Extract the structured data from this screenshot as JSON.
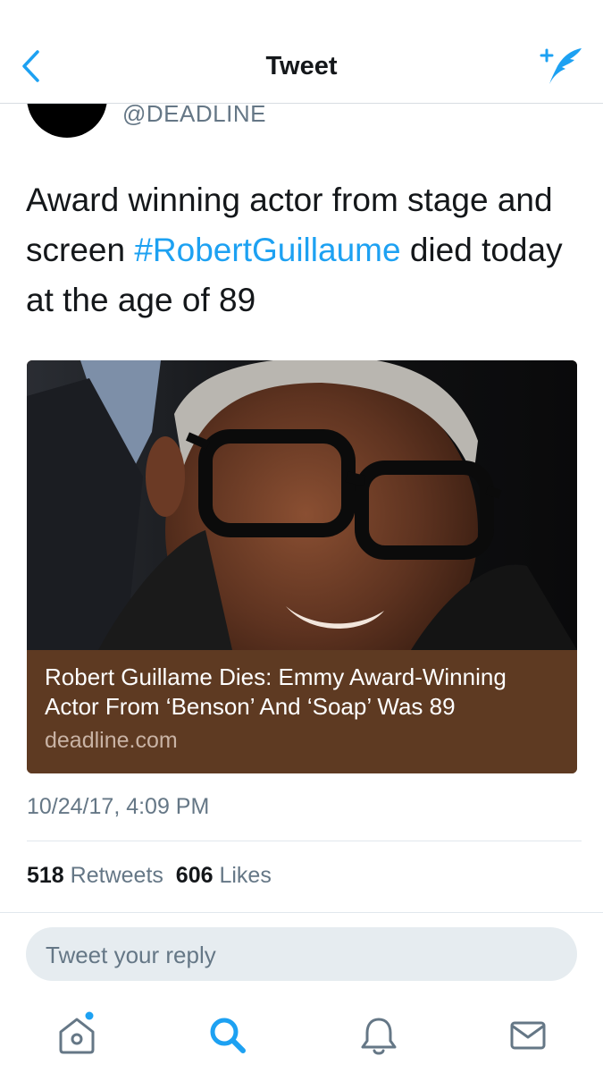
{
  "nav": {
    "title": "Tweet",
    "back_icon": "chevron-left-icon",
    "compose_icon": "compose-tweet-icon"
  },
  "author": {
    "handle": "@DEADLINE"
  },
  "tweet": {
    "text_before": "Award winning actor from stage and screen ",
    "hashtag": "#RobertGuillaume",
    "text_after": " died today at the age of 89"
  },
  "card": {
    "title": "Robert Guillame Dies: Emmy Award-Winning Actor From ‘Benson’ And ‘Soap’ Was 89",
    "domain": "deadline.com"
  },
  "timestamp": "10/24/17, 4:09 PM",
  "stats": {
    "retweets_count": "518",
    "retweets_label": "Retweets",
    "likes_count": "606",
    "likes_label": "Likes"
  },
  "reply": {
    "placeholder": "Tweet your reply"
  },
  "tabbar": {
    "items": [
      "home-icon",
      "search-icon",
      "notifications-icon",
      "messages-icon"
    ]
  },
  "colors": {
    "accent": "#1da1f2",
    "text": "#14171a",
    "muted": "#657786",
    "card_bg": "#5e3a22",
    "reply_bg": "#e6ecf0"
  }
}
